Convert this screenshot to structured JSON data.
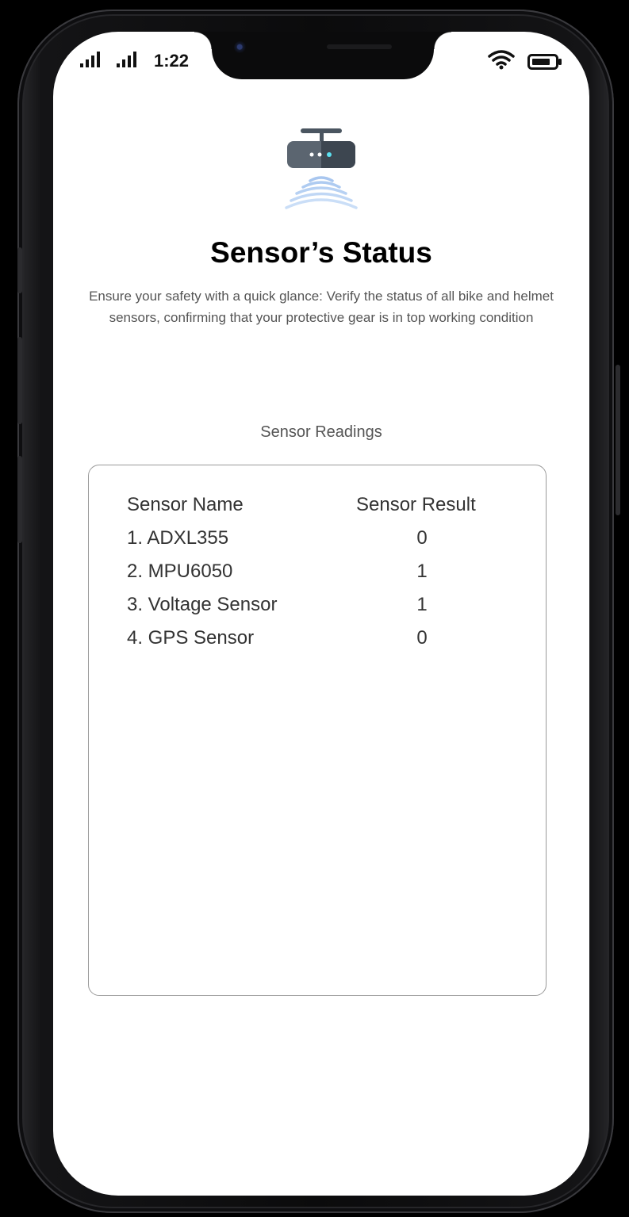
{
  "status_bar": {
    "time": "1:22",
    "signal_icons": [
      "signal-bars-icon",
      "signal-bars-icon"
    ],
    "right_icons": [
      "wifi-icon",
      "battery-icon"
    ]
  },
  "header": {
    "icon": "router-sensor-icon",
    "title": "Sensor’s Status",
    "description": "Ensure your safety with a quick glance: Verify the status of all bike and helmet sensors, confirming that your protective gear is in top working condition"
  },
  "readings": {
    "section_label": "Sensor Readings",
    "columns": [
      "Sensor Name",
      "Sensor Result"
    ],
    "rows": [
      {
        "name": "1. ADXL355",
        "result": "0"
      },
      {
        "name": "2. MPU6050",
        "result": "1"
      },
      {
        "name": "3. Voltage Sensor",
        "result": "1"
      },
      {
        "name": "4. GPS Sensor",
        "result": "0"
      }
    ]
  }
}
